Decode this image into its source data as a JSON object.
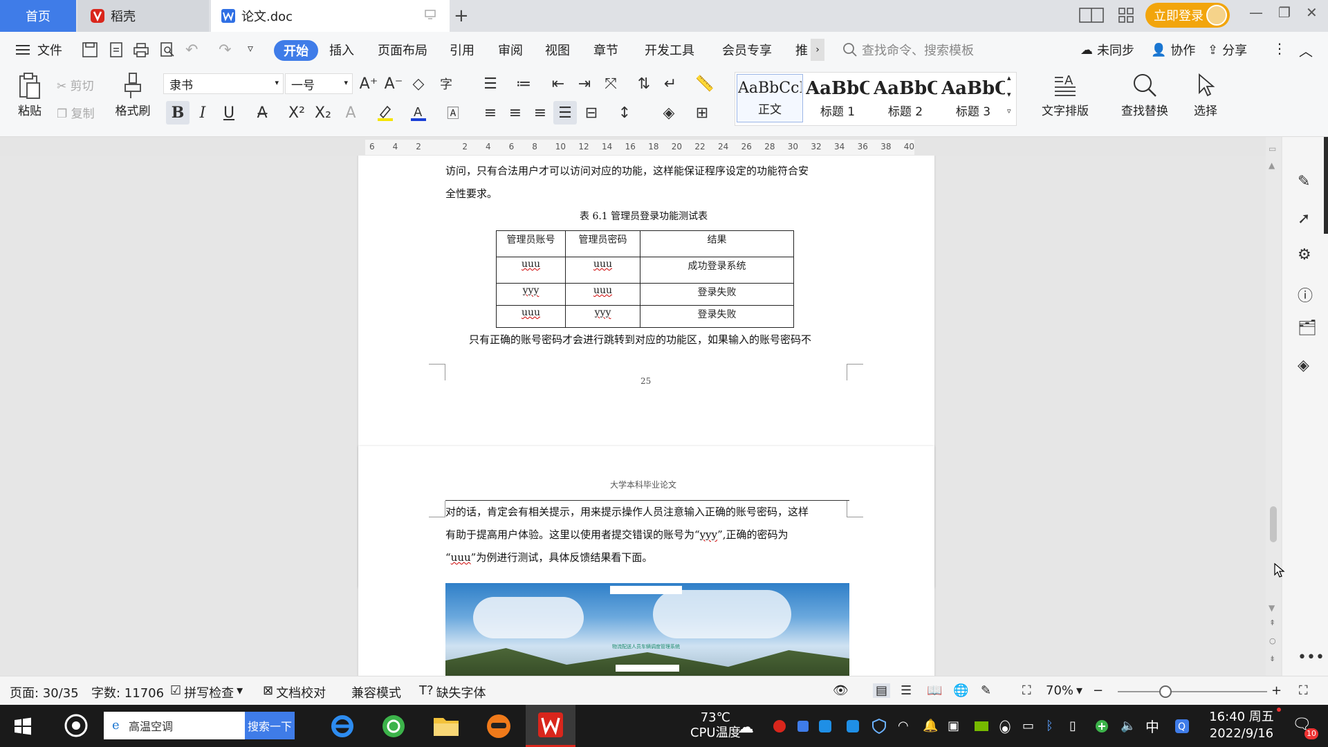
{
  "tabs": {
    "home": "首页",
    "daoke": "稻壳",
    "doc": "论文.doc"
  },
  "header": {
    "login": "立即登录"
  },
  "menu": {
    "file": "文件",
    "items": [
      "开始",
      "插入",
      "页面布局",
      "引用",
      "审阅",
      "视图",
      "章节",
      "开发工具",
      "会员专享",
      "推"
    ],
    "search_placeholder": "查找命令、搜索模板",
    "sync": "未同步",
    "collab": "协作",
    "share": "分享"
  },
  "ribbon": {
    "paste": "粘贴",
    "cut": "剪切",
    "copy": "复制",
    "format_painter": "格式刷",
    "font_name": "隶书",
    "font_size": "一号",
    "styles": [
      {
        "preview": "AaBbCcI",
        "label": "正文"
      },
      {
        "preview": "AaBbC",
        "label": "标题 1"
      },
      {
        "preview": "AaBbC",
        "label": "标题 2"
      },
      {
        "preview": "AaBbC",
        "label": "标题 3"
      }
    ],
    "text_layout": "文字排版",
    "find_replace": "查找替换",
    "select": "选择"
  },
  "ruler": {
    "ticks": [
      "6",
      "4",
      "2",
      "",
      "2",
      "4",
      "6",
      "8",
      "10",
      "12",
      "14",
      "16",
      "18",
      "20",
      "22",
      "24",
      "26",
      "28",
      "30",
      "32",
      "34",
      "36",
      "38",
      "40"
    ]
  },
  "page1": {
    "line1": "访问，只有合法用户才可以访问对应的功能，这样能保证程序设定的功能符合安",
    "line2": "全性要求。",
    "table_caption": "表 6.1  管理员登录功能测试表",
    "table_headers": [
      "管理员账号",
      "管理员密码",
      "结果"
    ],
    "table_rows": [
      [
        "uuu",
        "uuu",
        "成功登录系统"
      ],
      [
        "yyy",
        "uuu",
        "登录失败"
      ],
      [
        "uuu",
        "yyy",
        "登录失败"
      ]
    ],
    "line3": "只有正确的账号密码才会进行跳转到对应的功能区，如果输入的账号密码不",
    "page_number": "25"
  },
  "page2": {
    "header": "大学本科毕业论文",
    "line1": "对的话，肯定会有相关提示，用来提示操作人员注意输入正确的账号密码，这样",
    "line2a": "有助于提高用户体验。这里以使用者提交错误的账号为“",
    "line2w": "yyy",
    "line2b": "”,正确的密码为",
    "line3a": "“",
    "line3w": "uuu",
    "line3b": "”为例进行测试，具体反馈结果看下面。",
    "image_title": "物流配送人员车辆调度管理系统"
  },
  "status": {
    "page": "页面: 30/35",
    "words": "字数: 11706",
    "spell": "拼写检查",
    "proof": "文档校对",
    "compat": "兼容模式",
    "missing_font": "缺失字体",
    "zoom": "70%"
  },
  "taskbar": {
    "search_text": "高温空调",
    "search_button": "搜索一下",
    "temp": "73℃",
    "temp_label": "CPU温度",
    "ime": "中",
    "time": "16:40 周五",
    "date": "2022/9/16",
    "notif_count": "10"
  },
  "colors": {
    "accent": "#3f7ce8",
    "login": "#f2a50c",
    "wps_red": "#d9261c"
  }
}
